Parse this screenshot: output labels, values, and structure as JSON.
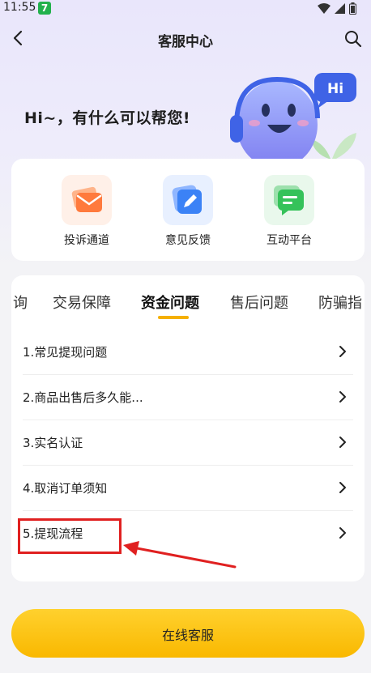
{
  "status_bar": {
    "time": "11:55",
    "badge_text": "7"
  },
  "header": {
    "title": "客服中心"
  },
  "hero": {
    "greeting": "Hi~，有什么可以帮您!",
    "bubble_text": "Hi"
  },
  "quick_actions": [
    {
      "label": "投诉通道",
      "icon": "complaint-envelope-icon",
      "color": "#ff7a3d"
    },
    {
      "label": "意见反馈",
      "icon": "feedback-pencil-icon",
      "color": "#3b82f6"
    },
    {
      "label": "互动平台",
      "icon": "chat-bubble-icon",
      "color": "#35c25a"
    }
  ],
  "tabs": [
    {
      "label": "询"
    },
    {
      "label": "交易保障"
    },
    {
      "label": "资金问题",
      "active": true
    },
    {
      "label": "售后问题"
    },
    {
      "label": "防骗指"
    }
  ],
  "faq_items": [
    {
      "label": "1.常见提现问题"
    },
    {
      "label": "2.商品出售后多久能..."
    },
    {
      "label": "3.实名认证"
    },
    {
      "label": "4.取消订单须知"
    },
    {
      "label": "5.提现流程"
    }
  ],
  "cta": {
    "label": "在线客服"
  },
  "colors": {
    "accent": "#f9b800",
    "annotation": "#e02020"
  }
}
